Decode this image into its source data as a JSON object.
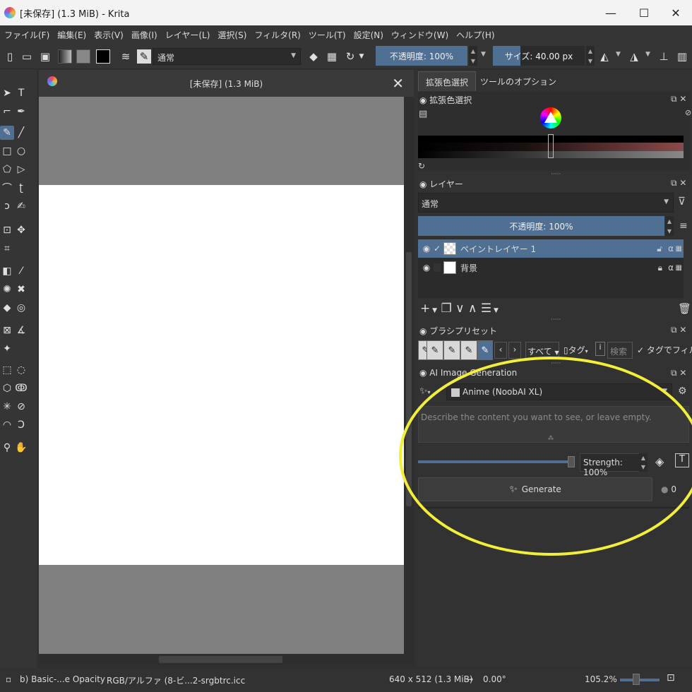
{
  "window": {
    "title": "[未保存]  (1.3 MiB)  - Krita",
    "minimize": "—",
    "maximize": "☐",
    "close": "✕"
  },
  "menu": [
    "ファイル(F)",
    "編集(E)",
    "表示(V)",
    "画像(I)",
    "レイヤー(L)",
    "選択(S)",
    "フィルタ(R)",
    "ツール(T)",
    "設定(N)",
    "ウィンドウ(W)",
    "ヘルプ(H)"
  ],
  "tool_options": {
    "blend_mode": "通常",
    "opacity": "不透明度: 100%",
    "size": "サイズ: 40.00 px"
  },
  "document": {
    "tab_title": "[未保存]  (1.3 MiB)",
    "close": "✕"
  },
  "dock_tabs": [
    "拡張色選択",
    "ツールのオプション"
  ],
  "color_panel": {
    "title": "拡張色選択"
  },
  "layers_panel": {
    "title": "レイヤー",
    "blend_mode": "通常",
    "opacity": "不透明度:  100%",
    "layers": [
      {
        "name": "ペイントレイヤー 1",
        "selected": true,
        "checked": "✓"
      },
      {
        "name": "背景",
        "selected": false,
        "checked": ""
      }
    ]
  },
  "brush_panel": {
    "title": "ブラシプリセット",
    "tag_filter": "すべて",
    "tag_label": "タグ",
    "search": "検索",
    "filter_by_tag": "タグでフィルタ"
  },
  "ai_panel": {
    "title": "AI Image Generation",
    "model": "Anime (NoobAI XL)",
    "prompt_placeholder": "Describe the content you want to see, or leave empty.",
    "strength": "Strength: 100%",
    "generate": "Generate",
    "queue_count": "0"
  },
  "status": {
    "brush": "b) Basic-...e Opacity",
    "color_space": "RGB/アルファ (8-ビ...2-srgbtrc.icc",
    "image_size": "640 x 512 (1.3 MiB)",
    "rotation": "0.00°",
    "zoom": "105.2%"
  },
  "colors": {
    "accent": "#4f6f93",
    "annotation": "#f2ef3a"
  }
}
